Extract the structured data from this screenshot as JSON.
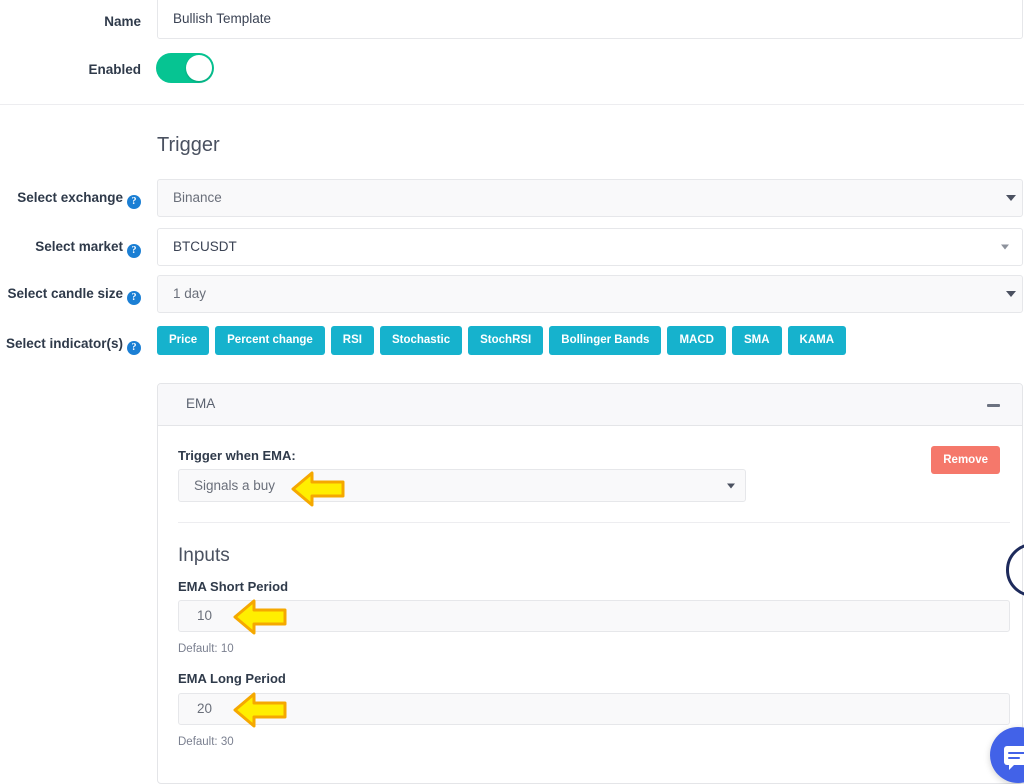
{
  "form": {
    "name": {
      "label": "Name",
      "value": "Bullish Template"
    },
    "enabled": {
      "label": "Enabled",
      "state": "on"
    }
  },
  "trigger": {
    "heading": "Trigger",
    "exchange": {
      "label": "Select exchange",
      "value": "Binance",
      "help": "?"
    },
    "market": {
      "label": "Select market",
      "value": "BTCUSDT",
      "help": "?"
    },
    "candle_size": {
      "label": "Select candle size",
      "value": "1 day",
      "help": "?"
    },
    "indicators": {
      "label": "Select indicator(s)",
      "help": "?",
      "options": [
        "Price",
        "Percent change",
        "RSI",
        "Stochastic",
        "StochRSI",
        "Bollinger Bands",
        "MACD",
        "SMA",
        "KAMA"
      ]
    }
  },
  "ema_card": {
    "title": "EMA",
    "collapse_icon": "minus-icon",
    "trigger_when_label": "Trigger when EMA:",
    "trigger_when_value": "Signals a buy",
    "remove_label": "Remove",
    "inputs_heading": "Inputs",
    "fields": [
      {
        "label": "EMA Short Period",
        "value": "10",
        "default_note": "Default: 10"
      },
      {
        "label": "EMA Long Period",
        "value": "20",
        "default_note": "Default: 30"
      }
    ]
  },
  "widgets": {
    "ring": "support-ring-widget",
    "chat": "chat-bubble-icon"
  },
  "colors": {
    "accent_teal": "#16b2cd",
    "toggle_green": "#06c492",
    "remove_red": "#f5786b",
    "help_blue": "#1b7fd4",
    "chat_blue": "#4262e8",
    "ring_navy": "#1d2a5b",
    "arrow_yellow": "#ffee00",
    "arrow_outline": "#f5a800"
  }
}
